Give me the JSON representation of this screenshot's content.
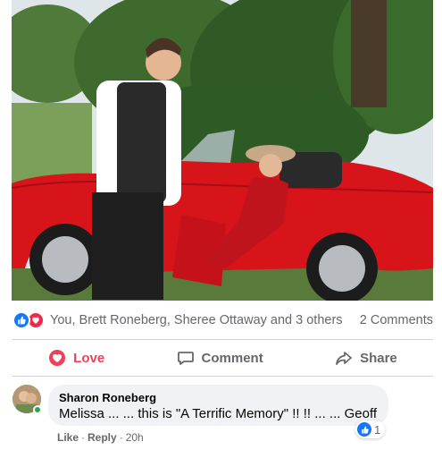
{
  "post": {
    "photo_alt": "",
    "reactions": {
      "icons": [
        "like-icon",
        "love-icon"
      ],
      "names": "You, Brett Roneberg, Sheree Ottaway and 3 others",
      "comments": "2 Comments"
    },
    "actions": {
      "love": "Love",
      "comment": "Comment",
      "share": "Share"
    }
  },
  "comment": {
    "author": "Sharon Roneberg",
    "text": "Melissa ... ... this is \"A Terrific Memory\" !! !! ... ... Geoff",
    "reaction_count": "1",
    "like": "Like",
    "reply": "Reply",
    "time": "20h"
  },
  "colors": {
    "like_blue": "#1877f2",
    "love_red": "#f33e58",
    "secondary_text": "#65676b",
    "bubble_bg": "#f0f2f5",
    "online_green": "#31a24c"
  }
}
